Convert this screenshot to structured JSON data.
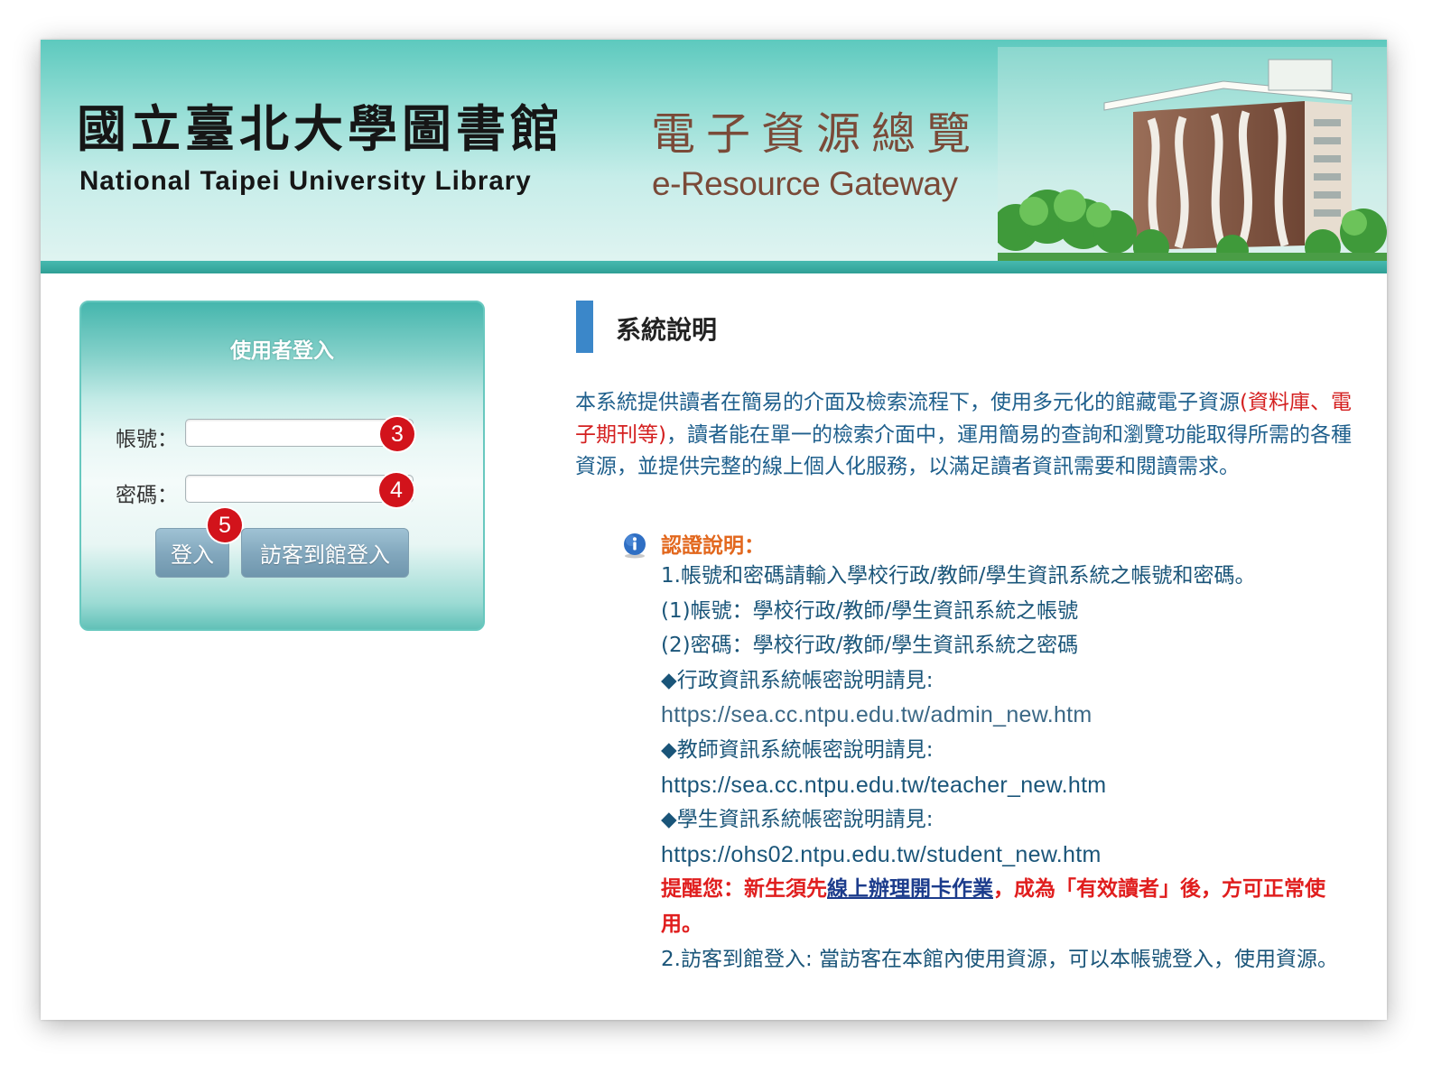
{
  "header": {
    "library_name_zh": "國立臺北大學圖書館",
    "library_name_en": "National Taipei University Library",
    "gateway_name_zh": "電子資源總覽",
    "gateway_name_en": "e-Resource Gateway"
  },
  "login": {
    "title": "使用者登入",
    "account_label": "帳號：",
    "account_value": "",
    "password_label": "密碼：",
    "password_value": "",
    "login_button": "登入",
    "guest_button": "訪客到館登入",
    "markers": {
      "account": "3",
      "password": "4",
      "login": "5"
    }
  },
  "description": {
    "title": "系統說明",
    "intro_part1": "本系統提供讀者在簡易的介面及檢索流程下，使用多元化的館藏電子資源",
    "intro_red": "(資料庫、電子期刊等)",
    "intro_part2": "，讀者能在單一的檢索介面中，運用簡易的查詢和瀏覽功能取得所需的各種資源，並提供完整的線上個人化服務，以滿足讀者資訊需要和閱讀需求。",
    "auth_title": "認證說明：",
    "auth_line1": "1.帳號和密碼請輸入學校行政/教師/學生資訊系統之帳號和密碼。",
    "auth_line2": "(1)帳號：學校行政/教師/學生資訊系統之帳號",
    "auth_line3": "(2)密碼：學校行政/教師/學生資訊系統之密碼",
    "admin_label": "◆行政資訊系統帳密說明請見:",
    "admin_url": "https://sea.cc.ntpu.edu.tw/admin_new.htm",
    "teacher_label": "◆教師資訊系統帳密說明請見:",
    "teacher_url": "https://sea.cc.ntpu.edu.tw/teacher_new.htm",
    "student_label": "◆學生資訊系統帳密說明請見:",
    "student_url": "https://ohs02.ntpu.edu.tw/student_new.htm",
    "reminder_prefix": "提醒您：新生須先",
    "reminder_link": "線上辦理開卡作業",
    "reminder_suffix": "，成為「有效讀者」後，方可正常使用。",
    "guest_line": "2.訪客到館登入: 當訪客在本館內使用資源，可以本帳號登入，使用資源。"
  },
  "colors": {
    "banner_teal": "#5dc9be",
    "accent_blue": "#3b87c9",
    "text_blue": "#1e5f8c",
    "highlight_red": "#d42020",
    "auth_orange": "#e2671d",
    "marker_red": "#d2131b"
  }
}
